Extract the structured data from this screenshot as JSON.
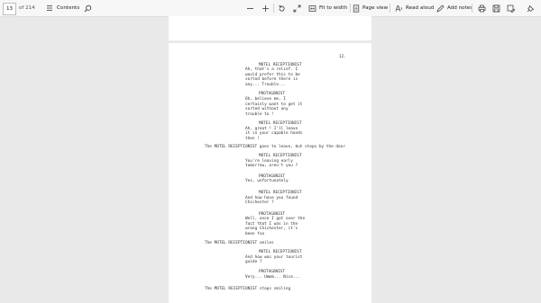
{
  "toolbar": {
    "current_page": "13",
    "page_count_label": "of 214",
    "contents_label": "Contents",
    "fit_width_label": "Fit to width",
    "page_view_label": "Page view",
    "read_aloud_label": "Read aloud",
    "add_notes_label": "Add notes"
  },
  "document": {
    "page_number": "12.",
    "script_lines": [
      "MOTEL RECEPTIONIST",
      "Ah, that's a relief. I",
      "would prefer this to be",
      "sorted before there is",
      "any... Trouble...",
      "PROTAGONIST",
      "Oh, believe me, I",
      "certainly want to get it",
      "sorted without any",
      "trouble to !",
      "MOTEL RECEPTIONIST",
      "Ah, great ! I'll leave",
      "it in your capable hands",
      "then !",
      "The MOTEL RECEPTIONIST goes to leave, but stops by the door",
      "MOTEL RECEPTIONIST",
      "You're leaving early",
      "tomorrow, aren't you ?",
      "PROTAGONIST",
      "Yes, unfortunately",
      "MOTEL RECEPTIONIST",
      "And how have you found",
      "Chichester ?",
      "PROTAGONIST",
      "Well, once I got over the",
      "fact that I was in the",
      "wrong Chichester, it's",
      "been fun",
      "The MOTEL RECEPTIONIST smiles",
      "MOTEL RECEPTIONIST",
      "And how was your tourist",
      "guide ?",
      "PROTAGONIST",
      "Very... Ummm... Nice...",
      "The MOTEL RECEPTIONIST stops smiling"
    ]
  }
}
